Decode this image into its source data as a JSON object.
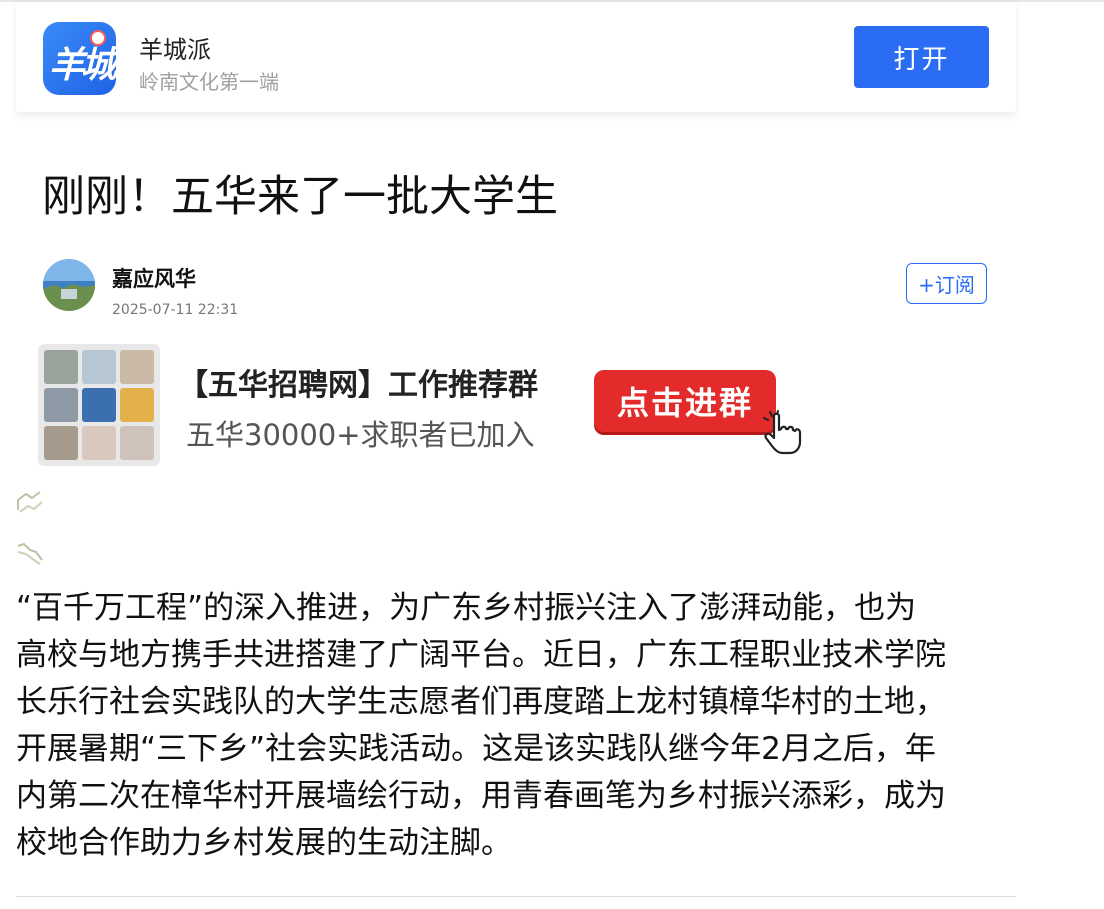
{
  "app_banner": {
    "logo_text": "羊城",
    "app_name": "羊城派",
    "slogan": "岭南文化第一端",
    "open_label": "打开"
  },
  "article": {
    "title": "刚刚！五华来了一批大学生",
    "author": "嘉应风华",
    "timestamp": "2025-07-11 22:31",
    "subscribe_label": "+订阅",
    "body_lines": [
      "“百千万工程”的深入推进，为广东乡村振兴注入了澎湃动能，也为",
      "高校与地方携手共进搭建了广阔平台。近日，广东工程职业技术学院",
      "长乐行社会实践队的大学生志愿者们再度踏上龙村镇樟华村的土地，",
      "开展暑期“三下乡”社会实践活动。这是该实践队继今年2月之后，年",
      "内第二次在樟华村开展墙绘行动，用青春画笔为乡村振兴添彩，成为",
      "校地合作助力乡村发展的生动注脚。"
    ]
  },
  "ad": {
    "title": "【五华招聘网】工作推荐群",
    "subtitle": "五华30000+求职者已加入",
    "button_label": "点击进群"
  },
  "colors": {
    "brand_blue": "#2a6df4",
    "ad_red": "#e42b2b"
  }
}
